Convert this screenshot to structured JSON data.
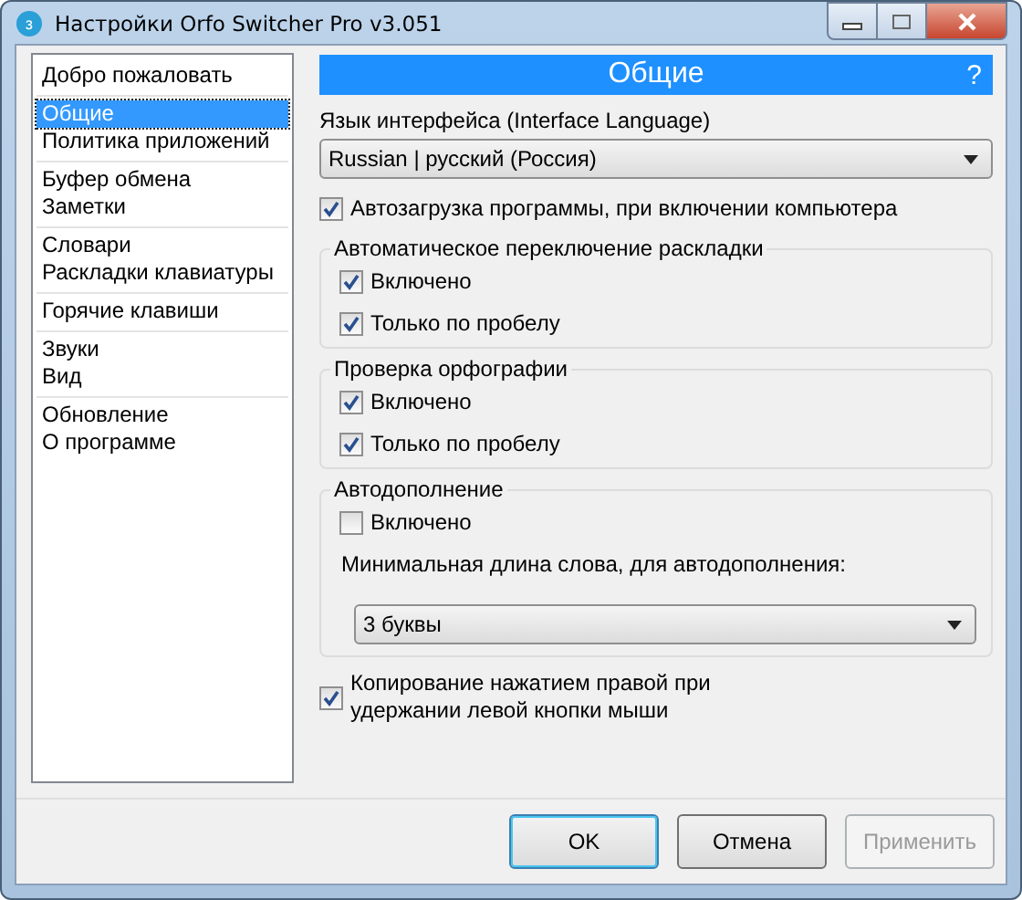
{
  "window": {
    "title": "Настройки Orfo Switcher Pro v3.051",
    "icon": "з"
  },
  "sidebar": {
    "groups": [
      {
        "items": [
          {
            "label": "Добро пожаловать",
            "selected": false
          }
        ]
      },
      {
        "items": [
          {
            "label": "Общие",
            "selected": true
          },
          {
            "label": "Политика приложений",
            "selected": false
          }
        ]
      },
      {
        "items": [
          {
            "label": "Буфер обмена",
            "selected": false
          },
          {
            "label": "Заметки",
            "selected": false
          }
        ]
      },
      {
        "items": [
          {
            "label": "Словари",
            "selected": false
          },
          {
            "label": "Раскладки клавиатуры",
            "selected": false
          }
        ]
      },
      {
        "items": [
          {
            "label": "Горячие клавиши",
            "selected": false
          }
        ]
      },
      {
        "items": [
          {
            "label": "Звуки",
            "selected": false
          },
          {
            "label": "Вид",
            "selected": false
          }
        ]
      },
      {
        "items": [
          {
            "label": "Обновление",
            "selected": false
          },
          {
            "label": "О программе",
            "selected": false
          }
        ]
      }
    ]
  },
  "panel": {
    "title": "Общие",
    "help": "?"
  },
  "language": {
    "label": "Язык интерфейса (Interface Language)",
    "value": "Russian | русский (Россия)"
  },
  "autostart": {
    "label": "Автозагрузка программы, при включении компьютера",
    "checked": true
  },
  "sections": [
    {
      "title": "Автоматическое переключение раскладки",
      "items": [
        {
          "kind": "checkbox",
          "label": "Включено",
          "checked": true
        },
        {
          "kind": "checkbox",
          "label": "Только по пробелу",
          "checked": true
        }
      ]
    },
    {
      "title": "Проверка орфографии",
      "items": [
        {
          "kind": "checkbox",
          "label": "Включено",
          "checked": true
        },
        {
          "kind": "checkbox",
          "label": "Только по пробелу",
          "checked": true
        }
      ]
    },
    {
      "title": "Автодополнение",
      "items": [
        {
          "kind": "checkbox",
          "label": "Включено",
          "checked": false
        },
        {
          "kind": "caption",
          "label": "Минимальная длина слова, для автодополнения:"
        },
        {
          "kind": "select",
          "value": "3 буквы"
        }
      ]
    }
  ],
  "copy": {
    "label": "Копирование нажатием правой при\nудержании левой кнопки мыши",
    "checked": true
  },
  "buttons": [
    {
      "label": "OK",
      "default": true,
      "disabled": false
    },
    {
      "label": "Отмена",
      "default": false,
      "disabled": false
    },
    {
      "label": "Применить",
      "default": false,
      "disabled": true
    }
  ]
}
